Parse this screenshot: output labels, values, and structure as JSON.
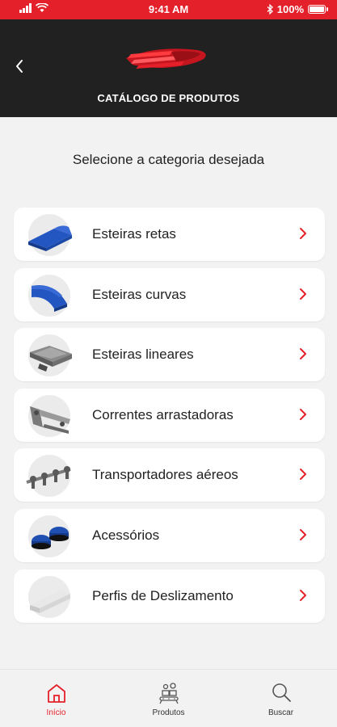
{
  "status_bar": {
    "time": "9:41 AM",
    "battery": "100%"
  },
  "header": {
    "title": "CATÁLOGO DE PRODUTOS",
    "back_icon": "chevron-left-icon",
    "logo": "brand-logo"
  },
  "subtitle": "Selecione a categoria desejada",
  "categories": [
    {
      "label": "Esteiras retas",
      "icon": "straight-conveyor-icon"
    },
    {
      "label": "Esteiras curvas",
      "icon": "curved-conveyor-icon"
    },
    {
      "label": "Esteiras lineares",
      "icon": "linear-conveyor-icon"
    },
    {
      "label": "Correntes arrastadoras",
      "icon": "drag-chain-icon"
    },
    {
      "label": "Transportadores aéreos",
      "icon": "overhead-conveyor-icon"
    },
    {
      "label": "Acessórios",
      "icon": "accessories-icon"
    },
    {
      "label": "Perfis de Deslizamento",
      "icon": "slide-profile-icon"
    }
  ],
  "tabs": [
    {
      "label": "Início",
      "icon": "home-icon",
      "active": true
    },
    {
      "label": "Produtos",
      "icon": "products-icon",
      "active": false
    },
    {
      "label": "Buscar",
      "icon": "search-icon",
      "active": false
    }
  ],
  "colors": {
    "accent": "#e4202a",
    "header_bg": "#212121",
    "page_bg": "#f2f2f2",
    "product_blue": "#1f4fb0"
  }
}
